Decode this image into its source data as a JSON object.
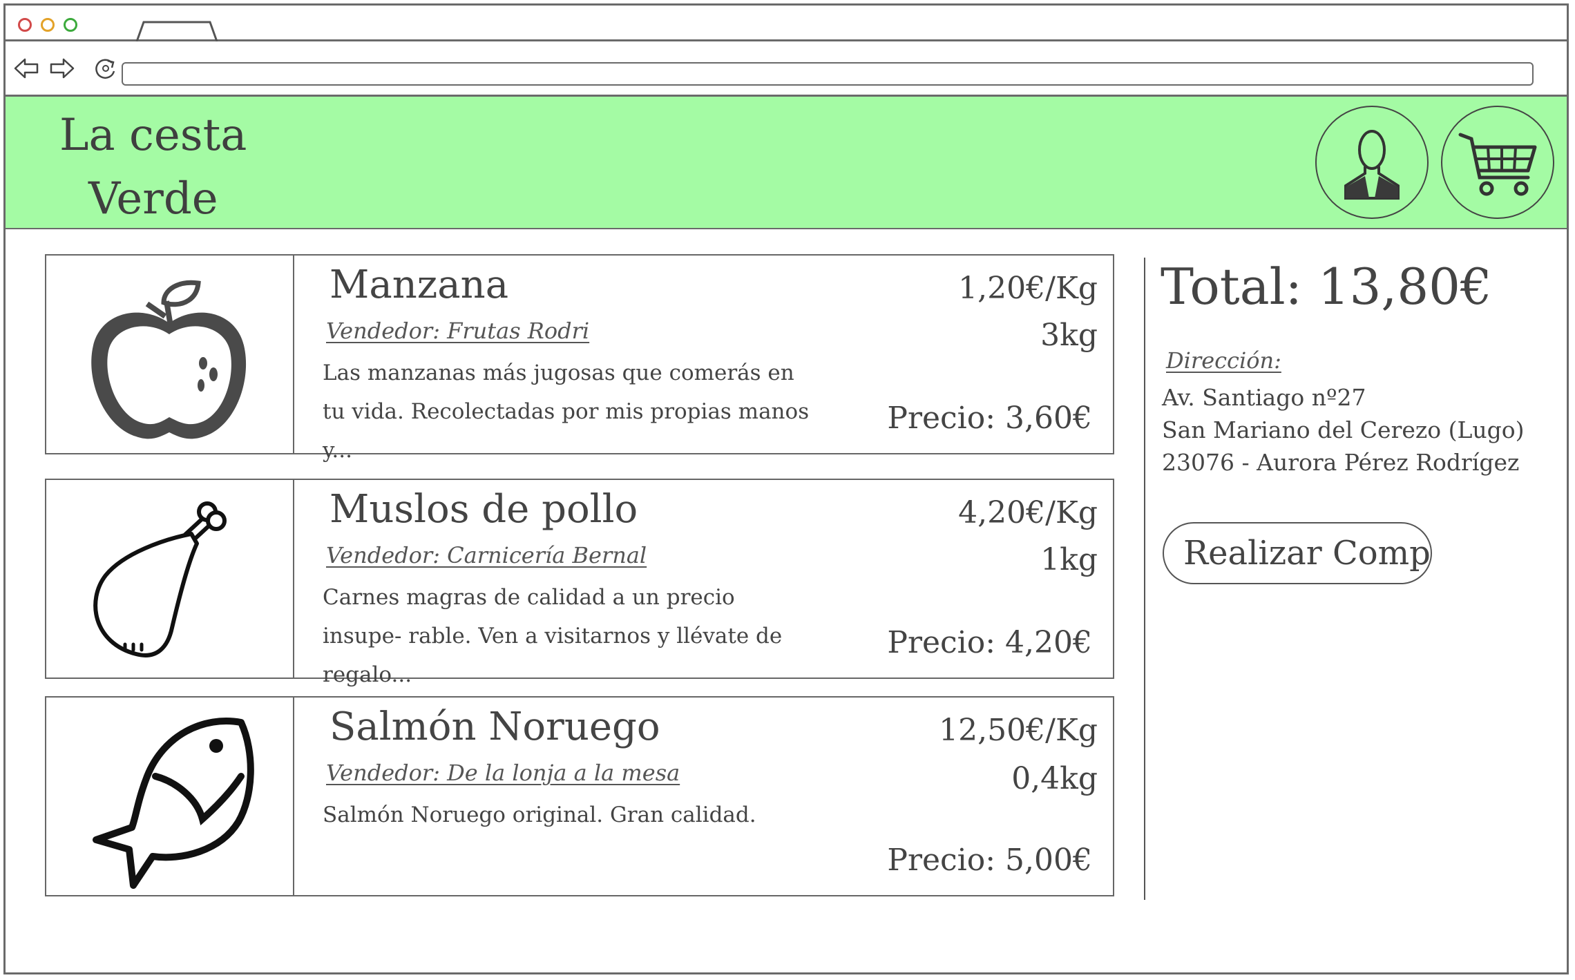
{
  "header": {
    "logo_line1": "La cesta",
    "logo_line2": "Verde"
  },
  "icons": {
    "profile": "user-avatar-icon",
    "cart": "shopping-cart-icon"
  },
  "products": [
    {
      "name": "Manzana",
      "vendor": "Vendedor: Frutas Rodri",
      "description": "Las manzanas más jugosas que comerás en tu vida. Recolectadas por mis propias manos y...",
      "unit_price": "1,20€/Kg",
      "quantity": "3kg",
      "price": "Precio: 3,60€",
      "icon": "apple-icon"
    },
    {
      "name": "Muslos de pollo",
      "vendor": "Vendedor: Carnicería Bernal",
      "description": "Carnes magras de calidad a un precio insupe- rable. Ven a visitarnos y llévate de regalo...",
      "unit_price": "4,20€/Kg",
      "quantity": "1kg",
      "price": "Precio: 4,20€",
      "icon": "chicken-leg-icon"
    },
    {
      "name": "Salmón Noruego",
      "vendor": "Vendedor: De la lonja a la mesa",
      "description": "Salmón Noruego original. Gran calidad.",
      "unit_price": "12,50€/Kg",
      "quantity": "0,4kg",
      "price": "Precio: 5,00€",
      "icon": "fish-icon"
    }
  ],
  "summary": {
    "total": "Total: 13,80€",
    "address_label": "Dirección:",
    "address_lines": [
      "Av. Santiago nº27",
      "San Mariano del Cerezo (Lugo)",
      "23076 - Aurora Pérez Rodrígez"
    ],
    "buy_button": "Realizar Compra"
  },
  "colors": {
    "header_bg": "#a4fba4",
    "ink": "#444444"
  }
}
